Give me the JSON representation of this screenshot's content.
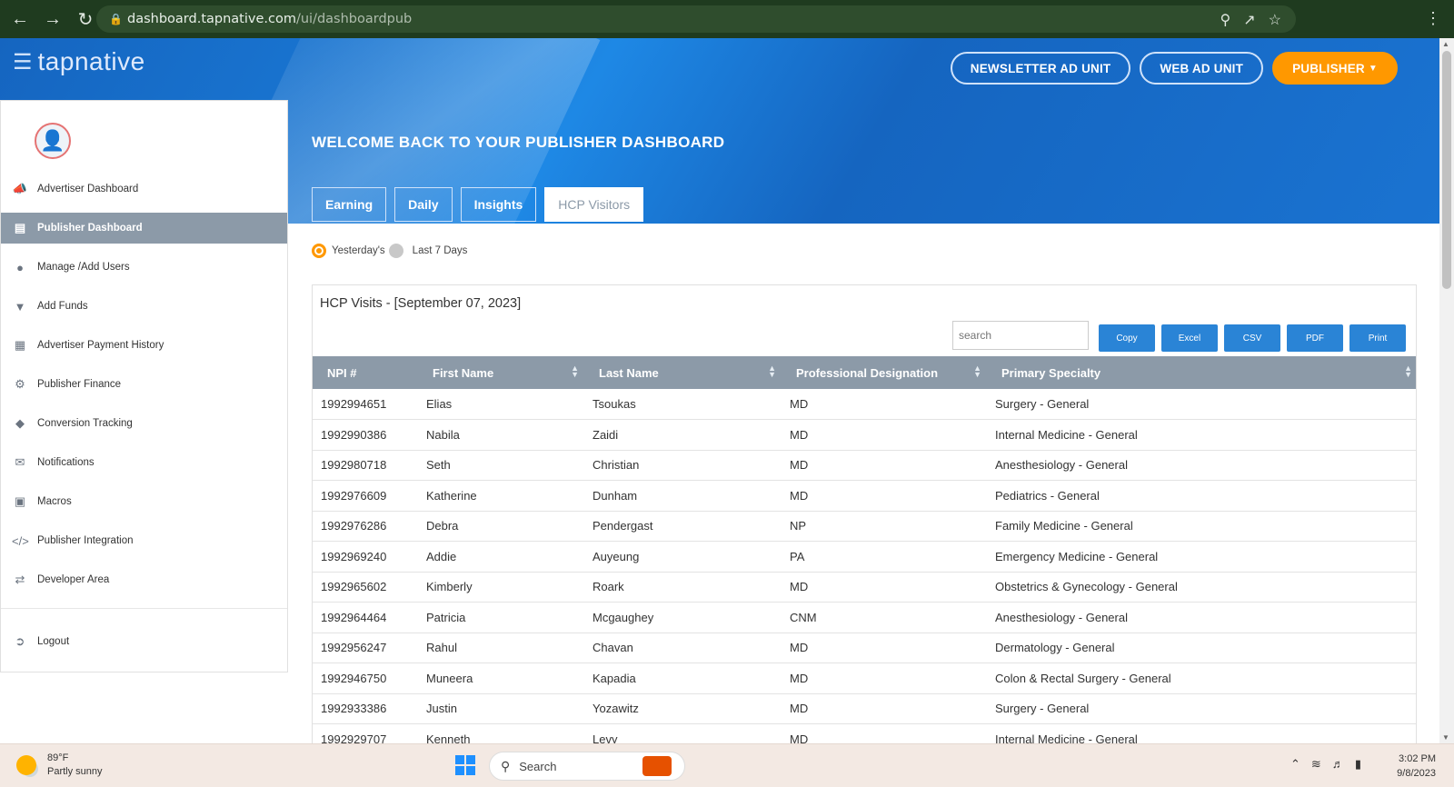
{
  "browser": {
    "url_host": "dashboard.tapnative.com",
    "url_path": "/ui/dashboardpub"
  },
  "header": {
    "logo_text": "tapnative",
    "buttons": [
      "NEWSLETTER AD UNIT",
      "WEB AD UNIT",
      "PUBLISHER"
    ],
    "welcome": "WELCOME BACK TO YOUR PUBLISHER DASHBOARD",
    "tabs": [
      "Earning",
      "Daily",
      "Insights",
      "HCP Visitors"
    ],
    "active_tab": "HCP Visitors"
  },
  "sidebar": {
    "items": [
      {
        "label": "Advertiser Dashboard",
        "icon": "megaphone-icon"
      },
      {
        "label": "Publisher Dashboard",
        "icon": "book-icon",
        "active": true
      },
      {
        "label": "Manage /Add Users",
        "icon": "user-icon"
      },
      {
        "label": "Add Funds",
        "icon": "funds-icon"
      },
      {
        "label": "Advertiser Payment History",
        "icon": "card-icon"
      },
      {
        "label": "Publisher Finance",
        "icon": "gear-icon"
      },
      {
        "label": "Conversion Tracking",
        "icon": "tag-icon"
      },
      {
        "label": "Notifications",
        "icon": "envelope-icon"
      },
      {
        "label": "Macros",
        "icon": "monitor-icon"
      },
      {
        "label": "Publisher Integration",
        "icon": "code-icon"
      },
      {
        "label": "Developer Area",
        "icon": "shuffle-icon"
      }
    ],
    "logout": "Logout"
  },
  "filters": {
    "options": [
      "Yesterday's",
      "Last 7 Days"
    ],
    "selected": "Yesterday's"
  },
  "panel": {
    "title": "HCP Visits - [September 07, 2023]",
    "search_placeholder": "search",
    "export_buttons": [
      "Copy",
      "Excel",
      "CSV",
      "PDF",
      "Print"
    ]
  },
  "table": {
    "columns": [
      "NPI #",
      "First Name",
      "Last Name",
      "Professional Designation",
      "Primary Specialty"
    ],
    "rows": [
      [
        "1992994651",
        "Elias",
        "Tsoukas",
        "MD",
        "Surgery - General"
      ],
      [
        "1992990386",
        "Nabila",
        "Zaidi",
        "MD",
        "Internal Medicine - General"
      ],
      [
        "1992980718",
        "Seth",
        "Christian",
        "MD",
        "Anesthesiology - General"
      ],
      [
        "1992976609",
        "Katherine",
        "Dunham",
        "MD",
        "Pediatrics - General"
      ],
      [
        "1992976286",
        "Debra",
        "Pendergast",
        "NP",
        "Family Medicine - General"
      ],
      [
        "1992969240",
        "Addie",
        "Auyeung",
        "PA",
        "Emergency Medicine - General"
      ],
      [
        "1992965602",
        "Kimberly",
        "Roark",
        "MD",
        "Obstetrics & Gynecology - General"
      ],
      [
        "1992964464",
        "Patricia",
        "Mcgaughey",
        "CNM",
        "Anesthesiology - General"
      ],
      [
        "1992956247",
        "Rahul",
        "Chavan",
        "MD",
        "Dermatology - General"
      ],
      [
        "1992946750",
        "Muneera",
        "Kapadia",
        "MD",
        "Colon & Rectal Surgery - General"
      ],
      [
        "1992933386",
        "Justin",
        "Yozawitz",
        "MD",
        "Surgery - General"
      ],
      [
        "1992929707",
        "Kenneth",
        "Levy",
        "MD",
        "Internal Medicine - General"
      ]
    ]
  },
  "taskbar": {
    "weather_temp": "89°F",
    "weather_desc": "Partly sunny",
    "search_label": "Search",
    "time": "3:02 PM",
    "date": "9/8/2023"
  },
  "colors": {
    "accent_orange": "#ff9800",
    "table_header": "#8c9aa8",
    "button_blue": "#2a84d6"
  }
}
